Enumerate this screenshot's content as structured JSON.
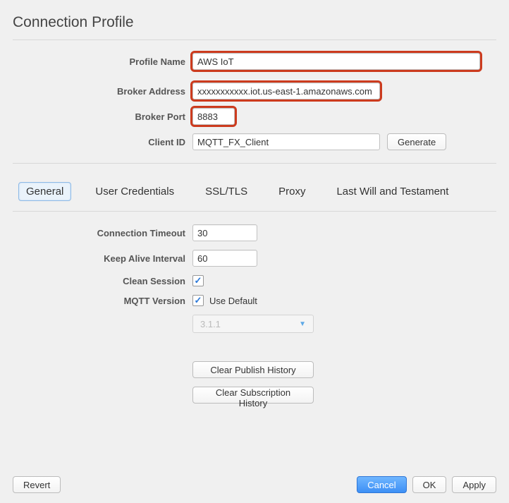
{
  "title": "Connection Profile",
  "form": {
    "profile_name": {
      "label": "Profile Name",
      "value": "AWS IoT"
    },
    "broker_address": {
      "label": "Broker Address",
      "value": "xxxxxxxxxxx.iot.us-east-1.amazonaws.com"
    },
    "broker_port": {
      "label": "Broker Port",
      "value": "8883"
    },
    "client_id": {
      "label": "Client ID",
      "value": "MQTT_FX_Client"
    },
    "generate": "Generate"
  },
  "tabs": {
    "general": "General",
    "user_credentials": "User Credentials",
    "ssl": "SSL/TLS",
    "proxy": "Proxy",
    "lwt": "Last Will and Testament"
  },
  "general": {
    "connection_timeout": {
      "label": "Connection Timeout",
      "value": "30"
    },
    "keep_alive": {
      "label": "Keep Alive Interval",
      "value": "60"
    },
    "clean_session": {
      "label": "Clean Session",
      "checked": true
    },
    "mqtt_version": {
      "label": "MQTT Version",
      "use_default_checked": true,
      "use_default_label": "Use Default",
      "selected": "3.1.1"
    },
    "clear_publish": "Clear Publish History",
    "clear_subscription": "Clear Subscription History"
  },
  "footer": {
    "revert": "Revert",
    "cancel": "Cancel",
    "ok": "OK",
    "apply": "Apply"
  }
}
